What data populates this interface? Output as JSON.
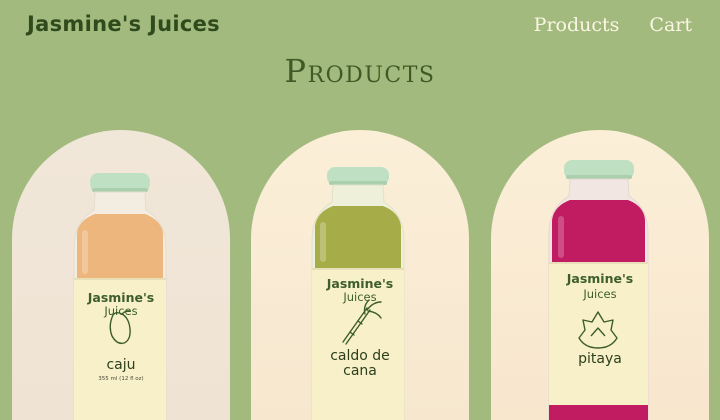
{
  "header": {
    "brand": "Jasmine's Juices",
    "nav": [
      {
        "label": "Products"
      },
      {
        "label": "Cart"
      }
    ]
  },
  "page": {
    "title": "Products"
  },
  "products": [
    {
      "brand_line1": "Jasmine's",
      "brand_line2": "Juices",
      "name": "caju",
      "volume": "355 ml (12 fl oz)",
      "icon": "cashew-fruit-icon",
      "liquid_color": "#edb67c",
      "label_color": "#f8f0c9"
    },
    {
      "brand_line1": "Jasmine's",
      "brand_line2": "Juices",
      "name_line1": "caldo de",
      "name_line2": "cana",
      "icon": "sugarcane-icon",
      "liquid_color": "#a6ad48",
      "label_color": "#f8f0c9"
    },
    {
      "brand_line1": "Jasmine's",
      "brand_line2": "Juices",
      "name": "pitaya",
      "icon": "dragon-fruit-icon",
      "liquid_color": "#c11c62",
      "label_color": "#f8f0c9"
    }
  ]
}
